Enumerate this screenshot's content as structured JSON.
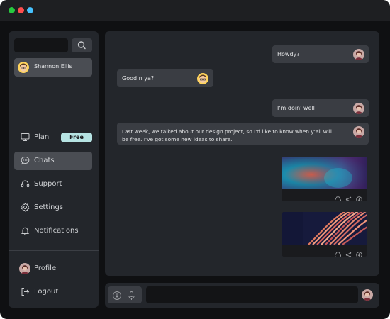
{
  "window": {
    "controls": [
      "window-close-dot",
      "window-minimize-dot",
      "window-maximize-dot"
    ]
  },
  "sidebar": {
    "search": {
      "value": "",
      "placeholder": "",
      "icon": "search-icon"
    },
    "contacts": [
      {
        "name": "Shannon Ellis",
        "icon": "avatar-cartoon-man-icon"
      }
    ],
    "nav": [
      {
        "label": "Plan",
        "icon": "monitor-icon",
        "badge": "Free"
      },
      {
        "label": "Chats",
        "icon": "chat-bubble-icon"
      },
      {
        "label": "Support",
        "icon": "support-icon"
      },
      {
        "label": "Settings",
        "icon": "gear-icon"
      },
      {
        "label": "Notifications",
        "icon": "bell-icon"
      }
    ],
    "account": [
      {
        "label": "Profile",
        "icon": "avatar-woman-icon"
      },
      {
        "label": "Logout",
        "icon": "logout-icon"
      }
    ]
  },
  "messages": [
    {
      "from": "me",
      "text": "Howdy?"
    },
    {
      "from": "contact",
      "text": "Good n ya?"
    },
    {
      "from": "me",
      "text": "I'm doin' well"
    },
    {
      "from": "me",
      "text_lines": [
        "Last week, we talked about our design project, so I'd like to know when y'all will",
        "be free. I've got some new ideas to share."
      ]
    },
    {
      "from": "me",
      "type": "image",
      "image": "abstract-blue-image",
      "actions": [
        "drive-icon",
        "share-icon",
        "download-icon"
      ]
    },
    {
      "from": "me",
      "type": "image",
      "image": "abstract-swirl-image",
      "actions": [
        "drive-icon",
        "share-icon",
        "download-icon"
      ]
    }
  ],
  "composer": {
    "value": "",
    "placeholder": "",
    "tools": [
      "attach-icon",
      "microphone-icon"
    ]
  },
  "colors": {
    "window": "#0f1012",
    "titlebar": "#1e1f22",
    "panel": "#23262b",
    "bubble": "#3a3d43",
    "active": "#4a4d53",
    "badge": "#b6e3e3"
  }
}
